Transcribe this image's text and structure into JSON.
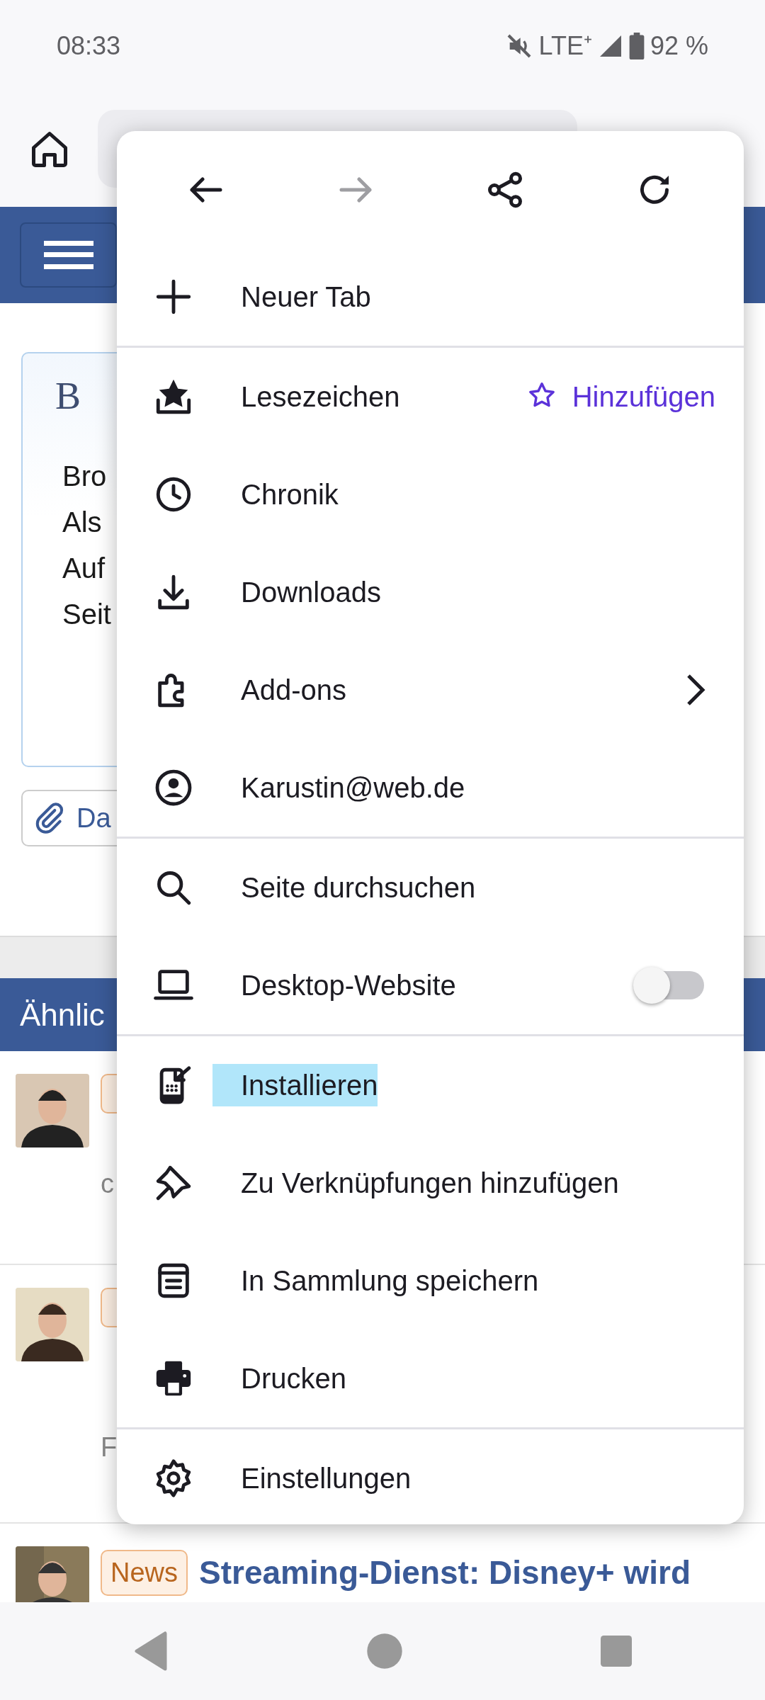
{
  "status_bar": {
    "time": "08:33",
    "network": "LTE⁺",
    "battery": "92 %"
  },
  "page": {
    "card_heading": "B",
    "card_lines": [
      "Bro",
      "Als",
      "Auf",
      "Seit"
    ],
    "attach_button": "Da",
    "section_title": "Ähnlic",
    "articles": [
      {
        "meta_lines": [
          "c"
        ]
      },
      {
        "meta_lines": [
          "F"
        ]
      },
      {
        "badge": "News",
        "title_lines": [
          "Streaming-Dienst: Disney+ wird"
        ]
      }
    ]
  },
  "menu": {
    "nav_buttons": [
      {
        "kind": "back",
        "disabled": false
      },
      {
        "kind": "forward",
        "disabled": true
      },
      {
        "kind": "share",
        "disabled": false
      },
      {
        "kind": "reload",
        "disabled": false
      }
    ],
    "sections": [
      [
        {
          "kind": "plain",
          "label": "Neuer Tab"
        }
      ],
      [
        {
          "kind": "action",
          "label": "Lesezeichen",
          "action": "Hinzufügen"
        },
        {
          "kind": "plain",
          "label": "Chronik"
        },
        {
          "kind": "plain",
          "label": "Downloads"
        },
        {
          "kind": "submenu",
          "label": "Add-ons"
        },
        {
          "kind": "plain",
          "label": "Karustin@web.de"
        }
      ],
      [
        {
          "kind": "plain",
          "label": "Seite durchsuchen"
        },
        {
          "kind": "toggle",
          "label": "Desktop-Website",
          "on": false
        }
      ],
      [
        {
          "kind": "plain",
          "label": "Installieren",
          "highlighted": true
        },
        {
          "kind": "plain",
          "label": "Zu Verknüpfungen hinzufügen",
          "highlighted": false
        },
        {
          "kind": "plain",
          "label": "In Sammlung speichern",
          "highlighted": false
        },
        {
          "kind": "plain",
          "label": "Drucken",
          "highlighted": false
        }
      ],
      [
        {
          "kind": "plain",
          "label": "Einstellungen"
        }
      ]
    ]
  }
}
